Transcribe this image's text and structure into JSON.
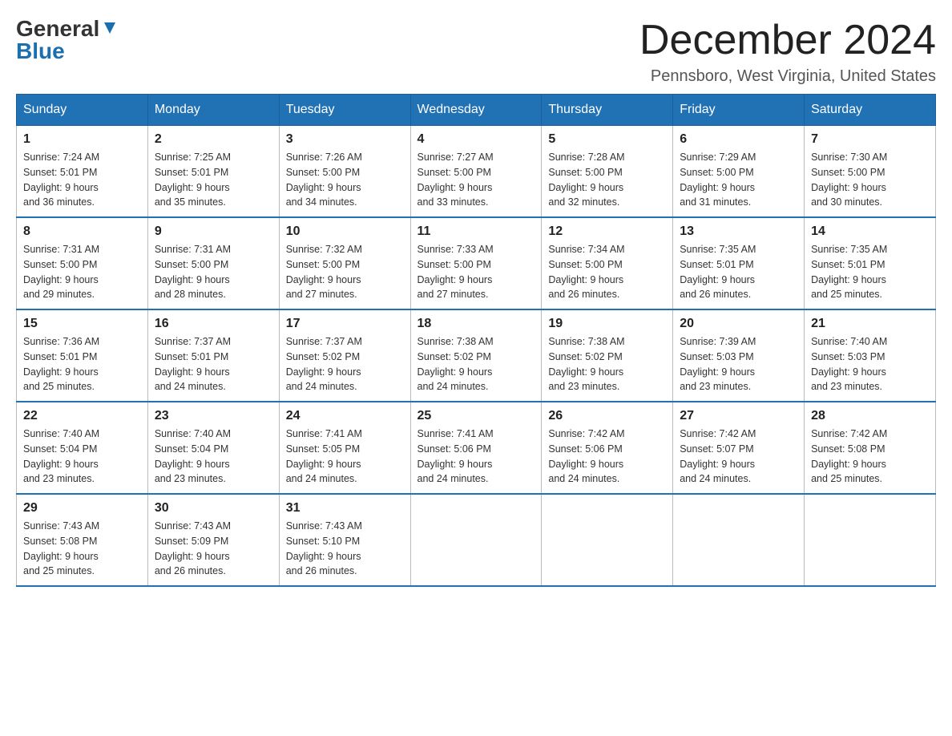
{
  "header": {
    "logo_general": "General",
    "logo_blue": "Blue",
    "month_title": "December 2024",
    "location": "Pennsboro, West Virginia, United States"
  },
  "days_of_week": [
    "Sunday",
    "Monday",
    "Tuesday",
    "Wednesday",
    "Thursday",
    "Friday",
    "Saturday"
  ],
  "weeks": [
    [
      {
        "day": "1",
        "sunrise": "7:24 AM",
        "sunset": "5:01 PM",
        "daylight": "9 hours and 36 minutes."
      },
      {
        "day": "2",
        "sunrise": "7:25 AM",
        "sunset": "5:01 PM",
        "daylight": "9 hours and 35 minutes."
      },
      {
        "day": "3",
        "sunrise": "7:26 AM",
        "sunset": "5:00 PM",
        "daylight": "9 hours and 34 minutes."
      },
      {
        "day": "4",
        "sunrise": "7:27 AM",
        "sunset": "5:00 PM",
        "daylight": "9 hours and 33 minutes."
      },
      {
        "day": "5",
        "sunrise": "7:28 AM",
        "sunset": "5:00 PM",
        "daylight": "9 hours and 32 minutes."
      },
      {
        "day": "6",
        "sunrise": "7:29 AM",
        "sunset": "5:00 PM",
        "daylight": "9 hours and 31 minutes."
      },
      {
        "day": "7",
        "sunrise": "7:30 AM",
        "sunset": "5:00 PM",
        "daylight": "9 hours and 30 minutes."
      }
    ],
    [
      {
        "day": "8",
        "sunrise": "7:31 AM",
        "sunset": "5:00 PM",
        "daylight": "9 hours and 29 minutes."
      },
      {
        "day": "9",
        "sunrise": "7:31 AM",
        "sunset": "5:00 PM",
        "daylight": "9 hours and 28 minutes."
      },
      {
        "day": "10",
        "sunrise": "7:32 AM",
        "sunset": "5:00 PM",
        "daylight": "9 hours and 27 minutes."
      },
      {
        "day": "11",
        "sunrise": "7:33 AM",
        "sunset": "5:00 PM",
        "daylight": "9 hours and 27 minutes."
      },
      {
        "day": "12",
        "sunrise": "7:34 AM",
        "sunset": "5:00 PM",
        "daylight": "9 hours and 26 minutes."
      },
      {
        "day": "13",
        "sunrise": "7:35 AM",
        "sunset": "5:01 PM",
        "daylight": "9 hours and 26 minutes."
      },
      {
        "day": "14",
        "sunrise": "7:35 AM",
        "sunset": "5:01 PM",
        "daylight": "9 hours and 25 minutes."
      }
    ],
    [
      {
        "day": "15",
        "sunrise": "7:36 AM",
        "sunset": "5:01 PM",
        "daylight": "9 hours and 25 minutes."
      },
      {
        "day": "16",
        "sunrise": "7:37 AM",
        "sunset": "5:01 PM",
        "daylight": "9 hours and 24 minutes."
      },
      {
        "day": "17",
        "sunrise": "7:37 AM",
        "sunset": "5:02 PM",
        "daylight": "9 hours and 24 minutes."
      },
      {
        "day": "18",
        "sunrise": "7:38 AM",
        "sunset": "5:02 PM",
        "daylight": "9 hours and 24 minutes."
      },
      {
        "day": "19",
        "sunrise": "7:38 AM",
        "sunset": "5:02 PM",
        "daylight": "9 hours and 23 minutes."
      },
      {
        "day": "20",
        "sunrise": "7:39 AM",
        "sunset": "5:03 PM",
        "daylight": "9 hours and 23 minutes."
      },
      {
        "day": "21",
        "sunrise": "7:40 AM",
        "sunset": "5:03 PM",
        "daylight": "9 hours and 23 minutes."
      }
    ],
    [
      {
        "day": "22",
        "sunrise": "7:40 AM",
        "sunset": "5:04 PM",
        "daylight": "9 hours and 23 minutes."
      },
      {
        "day": "23",
        "sunrise": "7:40 AM",
        "sunset": "5:04 PM",
        "daylight": "9 hours and 23 minutes."
      },
      {
        "day": "24",
        "sunrise": "7:41 AM",
        "sunset": "5:05 PM",
        "daylight": "9 hours and 24 minutes."
      },
      {
        "day": "25",
        "sunrise": "7:41 AM",
        "sunset": "5:06 PM",
        "daylight": "9 hours and 24 minutes."
      },
      {
        "day": "26",
        "sunrise": "7:42 AM",
        "sunset": "5:06 PM",
        "daylight": "9 hours and 24 minutes."
      },
      {
        "day": "27",
        "sunrise": "7:42 AM",
        "sunset": "5:07 PM",
        "daylight": "9 hours and 24 minutes."
      },
      {
        "day": "28",
        "sunrise": "7:42 AM",
        "sunset": "5:08 PM",
        "daylight": "9 hours and 25 minutes."
      }
    ],
    [
      {
        "day": "29",
        "sunrise": "7:43 AM",
        "sunset": "5:08 PM",
        "daylight": "9 hours and 25 minutes."
      },
      {
        "day": "30",
        "sunrise": "7:43 AM",
        "sunset": "5:09 PM",
        "daylight": "9 hours and 26 minutes."
      },
      {
        "day": "31",
        "sunrise": "7:43 AM",
        "sunset": "5:10 PM",
        "daylight": "9 hours and 26 minutes."
      },
      null,
      null,
      null,
      null
    ]
  ]
}
